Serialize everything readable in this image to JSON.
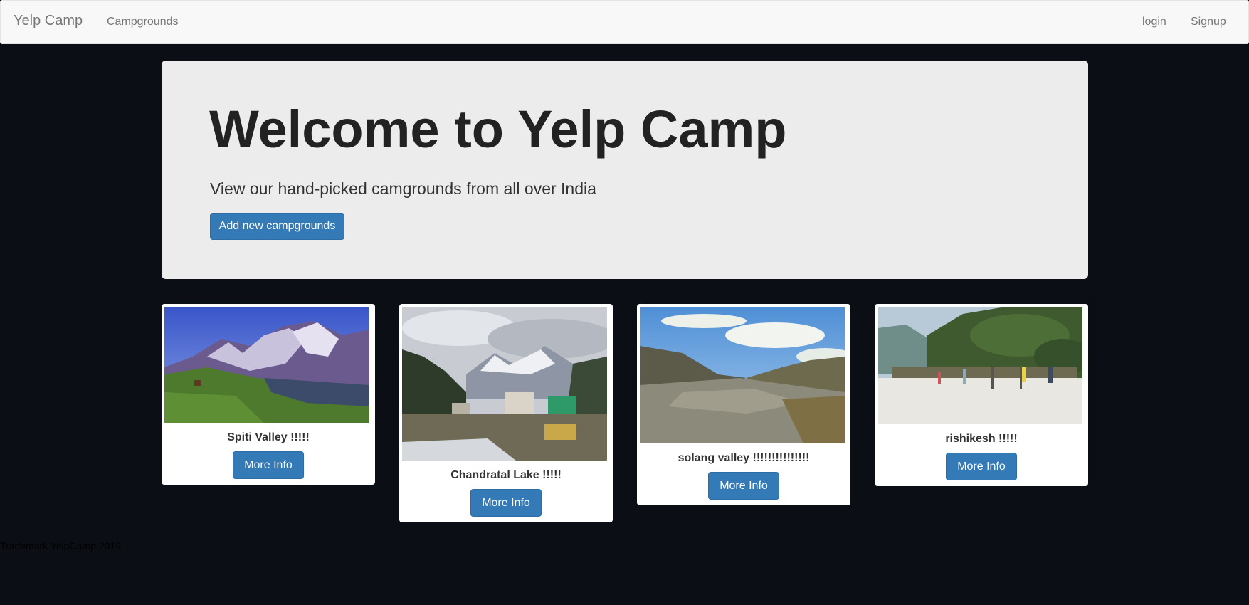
{
  "navbar": {
    "brand": "Yelp Camp",
    "links": [
      "Campgrounds"
    ],
    "right_links": [
      "login",
      "Signup"
    ]
  },
  "jumbotron": {
    "title": "Welcome to Yelp Camp",
    "subtitle": "View our hand-picked camgrounds from all over India",
    "add_button": "Add new campgrounds"
  },
  "campgrounds": [
    {
      "name": "Spiti Valley !!!!!",
      "button": "More Info"
    },
    {
      "name": "Chandratal Lake !!!!!",
      "button": "More Info"
    },
    {
      "name": "solang valley !!!!!!!!!!!!!!!",
      "button": "More Info"
    },
    {
      "name": "rishikesh !!!!!",
      "button": "More Info"
    }
  ],
  "footer": {
    "text": "Trademark YelpCamp 2019"
  },
  "colors": {
    "page_background": "#0b0e15",
    "primary_button": "#337ab7",
    "navbar": "#f8f8f8",
    "jumbotron": "#ececec"
  }
}
